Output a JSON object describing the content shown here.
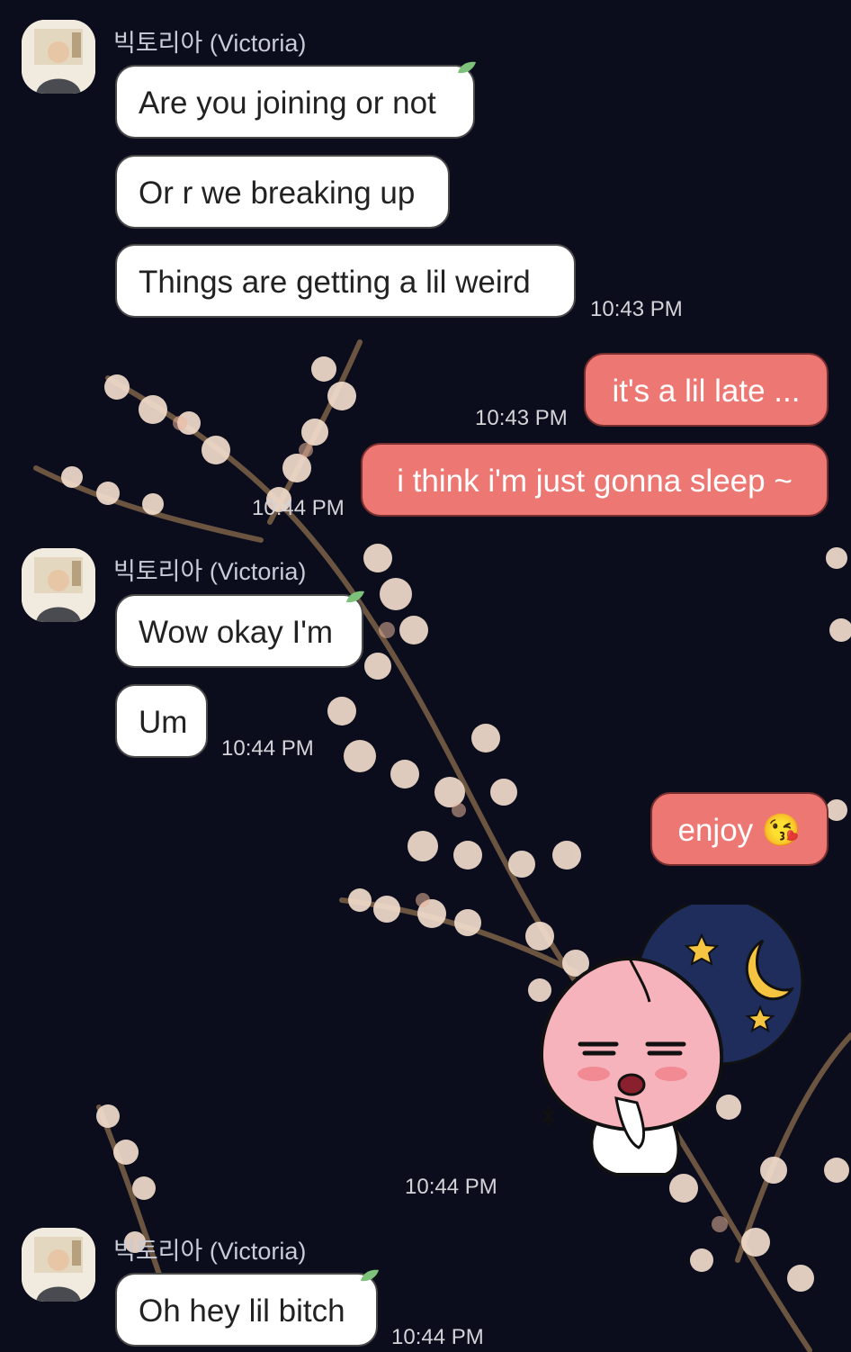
{
  "chat": {
    "sender_name": "빅토리아 (Victoria)",
    "msg1": "Are you joining or not",
    "msg2": "Or r we breaking up",
    "msg3": "Things are getting a lil weird",
    "time1": "10:43 PM",
    "reply1": "it's a lil late ...",
    "time2": "10:43 PM",
    "reply2": "i think i'm just gonna sleep ~",
    "time3": "10:44 PM",
    "msg4": "Wow okay I'm",
    "msg5": "Um",
    "time4": "10:44 PM",
    "reply3": "enjoy 😘",
    "time5": "10:44 PM",
    "msg6": "Oh hey lil bitch",
    "time6": "10:44 PM"
  },
  "colors": {
    "background": "#0b0d1c",
    "incoming_bubble": "#ffffff",
    "outgoing_bubble": "#ed7873",
    "leaf_badge": "#7cc27a"
  },
  "icons": {
    "avatar": "profile-avatar",
    "sticker": "sleepy-peach-sticker",
    "moon": "crescent-moon-icon"
  }
}
